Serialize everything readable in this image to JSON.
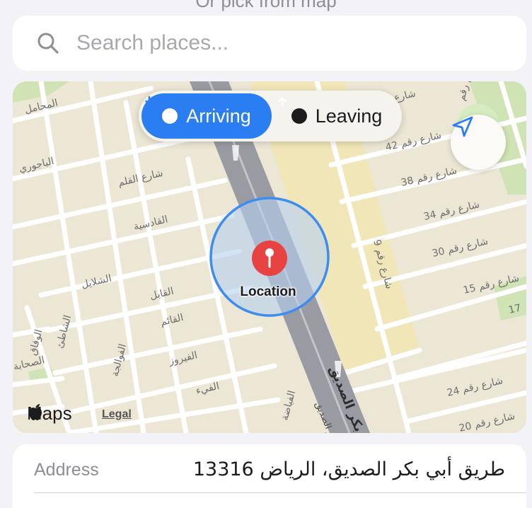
{
  "top_hint": "Or pick from map",
  "search": {
    "placeholder": "Search places..."
  },
  "mode": {
    "arriving_label": "Arriving",
    "leaving_label": "Leaving",
    "selected": "arriving",
    "accent": "#2b7ef2"
  },
  "map": {
    "location_label": "Location",
    "brand": "Maps",
    "legal": "Legal",
    "pin_color": "#e84343",
    "street_labels": [
      "المحامل",
      "الباجوري",
      "شارع القلم",
      "القادسية",
      "الشلايل",
      "القابل",
      "القائم",
      "الفوالجة",
      "الفيروز",
      "الوفاق",
      "الشاطئ",
      "الصحابة",
      "الفيء",
      "الفياضة",
      "ابي بكر الصديق",
      "بكر الصديق",
      "شارع رقم 42",
      "شارع رقم 38",
      "شارع رقم 34",
      "شارع رقم 30",
      "شارع رقم 15",
      "شارع رقم 9",
      "شارع رقم 24",
      "شارع رقم 20",
      "شارع",
      "شارع رقم",
      "17"
    ]
  },
  "address": {
    "label": "Address",
    "value": "طريق أبي بكر الصديق، الرياض 13316"
  },
  "icons": {
    "search": "magnifier-icon",
    "arriving": "arrow-down-circle-icon",
    "leaving": "arrow-up-circle-icon",
    "locate": "location-arrow-icon",
    "apple": "apple-logo-icon",
    "pin": "map-pin-icon"
  }
}
